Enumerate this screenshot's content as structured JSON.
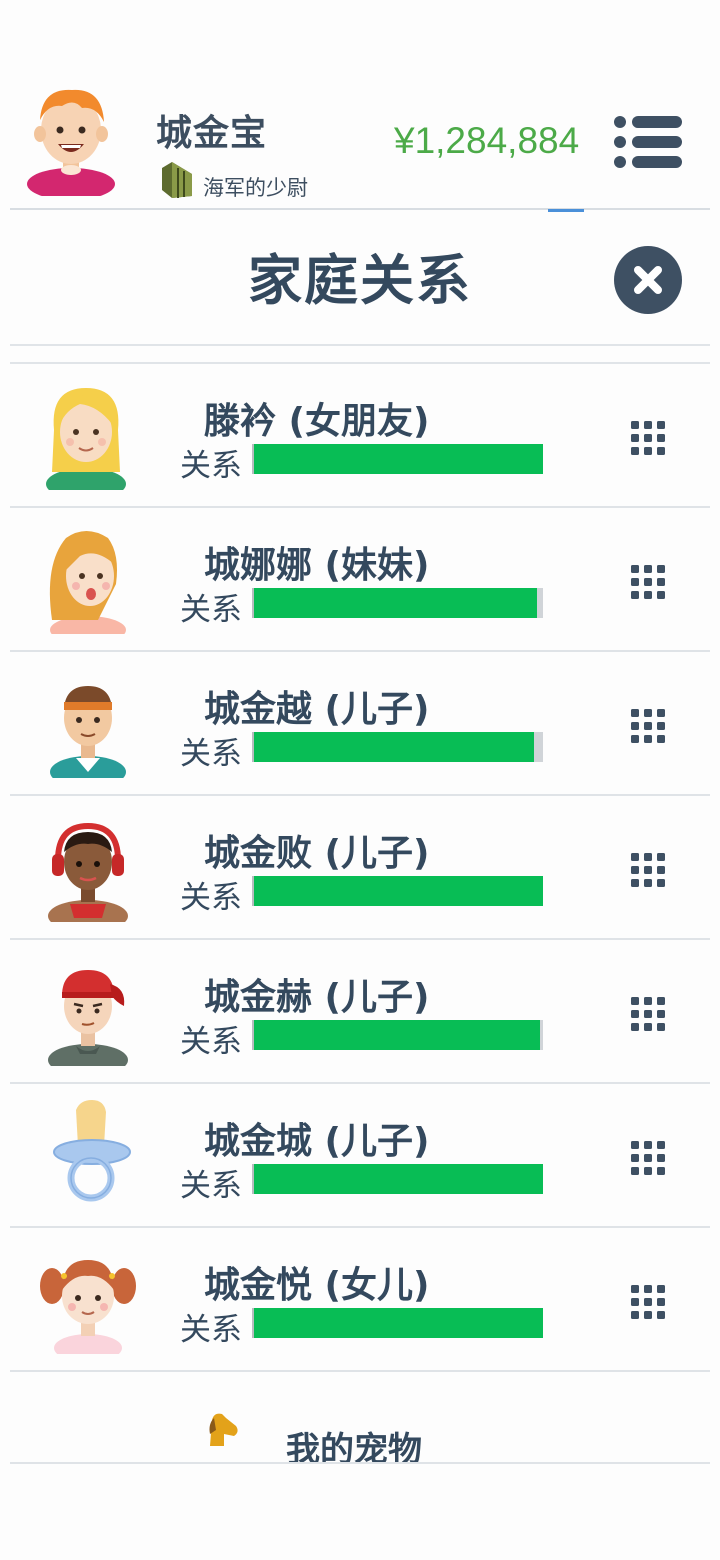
{
  "player": {
    "name": "城金宝",
    "rank": "海军的少尉",
    "money": "¥1,284,884"
  },
  "panel": {
    "title": "家庭关系"
  },
  "relation_label": "关系",
  "family": [
    {
      "name": "滕衿 (女朋友)",
      "relationship": 1.0,
      "avatar": "blonde-woman-avatar"
    },
    {
      "name": "城娜娜 (妹妹)",
      "relationship": 0.98,
      "avatar": "long-hair-girl-avatar"
    },
    {
      "name": "城金越 (儿子)",
      "relationship": 0.97,
      "avatar": "headband-boy-avatar"
    },
    {
      "name": "城金败 (儿子)",
      "relationship": 1.0,
      "avatar": "headphones-boy-avatar"
    },
    {
      "name": "城金赫 (儿子)",
      "relationship": 0.99,
      "avatar": "red-cap-boy-avatar"
    },
    {
      "name": "城金城 (儿子)",
      "relationship": 1.0,
      "avatar": "pacifier-baby-avatar"
    },
    {
      "name": "城金悦 (女儿)",
      "relationship": 1.0,
      "avatar": "pigtails-girl-avatar"
    }
  ],
  "pets": {
    "label": "我的宠物"
  },
  "colors": {
    "money": "#4caa48",
    "bar_fill": "#08bd55",
    "text": "#34495e"
  }
}
